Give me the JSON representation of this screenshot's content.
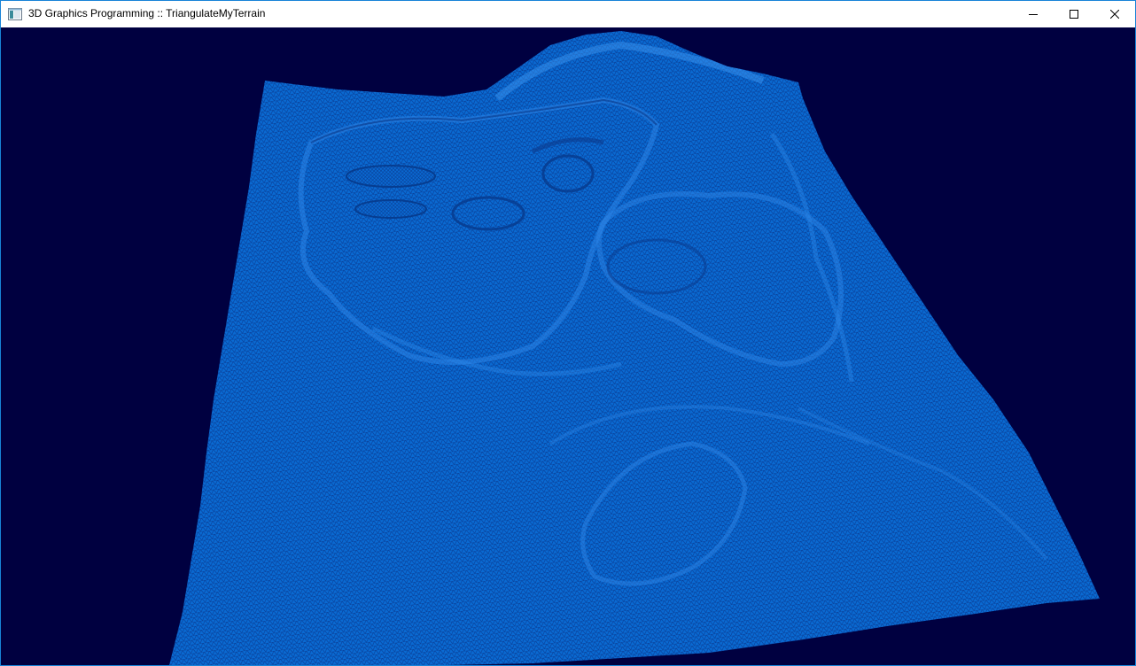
{
  "window": {
    "title": "3D Graphics Programming :: TriangulateMyTerrain",
    "app_icon": "window-app-icon",
    "controls": {
      "minimize_icon": "minimize-icon",
      "maximize_icon": "maximize-icon",
      "close_icon": "close-icon"
    }
  },
  "viewport": {
    "background_color": "#000040",
    "mesh_color": "#0a6ad2",
    "mesh_line_color": "#000c60",
    "render_mode": "wireframe terrain mesh"
  }
}
